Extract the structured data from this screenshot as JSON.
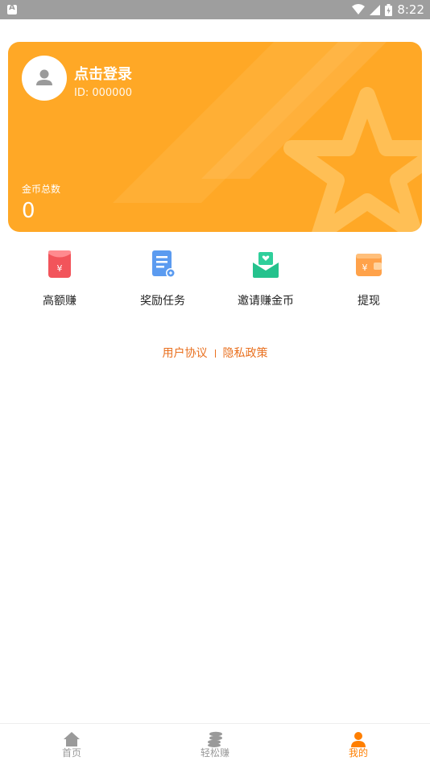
{
  "status_bar": {
    "time": "8:22",
    "icons": [
      "notification-icon",
      "wifi-icon",
      "signal-icon",
      "battery-icon"
    ]
  },
  "profile": {
    "login_title": "点击登录",
    "user_id": "ID: 000000",
    "coin_label": "金币总数",
    "coin_value": "0",
    "avatar_icon": "user-icon",
    "card_color": "#ffa826"
  },
  "menu": {
    "items": [
      {
        "label": "高额赚",
        "icon": "red-envelope-icon"
      },
      {
        "label": "奖励任务",
        "icon": "task-list-icon"
      },
      {
        "label": "邀请赚金币",
        "icon": "heart-envelope-icon"
      },
      {
        "label": "提现",
        "icon": "wallet-icon"
      }
    ]
  },
  "links": {
    "user_agreement": "用户协议",
    "privacy_policy": "隐私政策",
    "color": "#e9701f"
  },
  "tab_bar": {
    "tabs": [
      {
        "label": "首页",
        "icon": "home-icon",
        "active": false
      },
      {
        "label": "轻松赚",
        "icon": "coins-icon",
        "active": false
      },
      {
        "label": "我的",
        "icon": "person-icon",
        "active": true
      }
    ],
    "active_color": "#ff7f00"
  }
}
